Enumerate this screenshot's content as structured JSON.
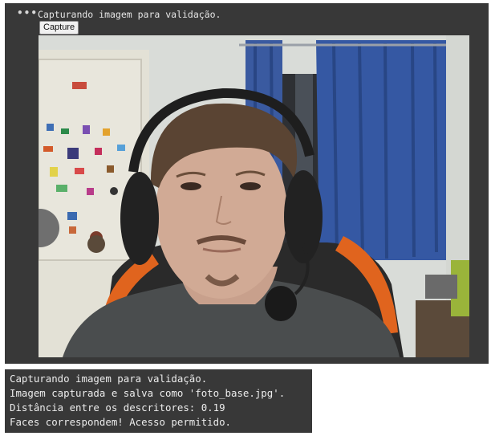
{
  "cell": {
    "menu_icon": "ellipsis-icon",
    "status_text": "Capturando imagem para validação.",
    "capture_button_label": "Capture"
  },
  "video": {
    "content": "webcam-frame"
  },
  "output": {
    "lines": [
      "Capturando imagem para validação.",
      "Imagem capturada e salva como 'foto_base.jpg'.",
      "Distância entre os descritores: 0.19",
      "Faces correspondem! Acesso permitido."
    ]
  },
  "colors": {
    "cell_background": "#383838",
    "output_text": "#ececec"
  }
}
